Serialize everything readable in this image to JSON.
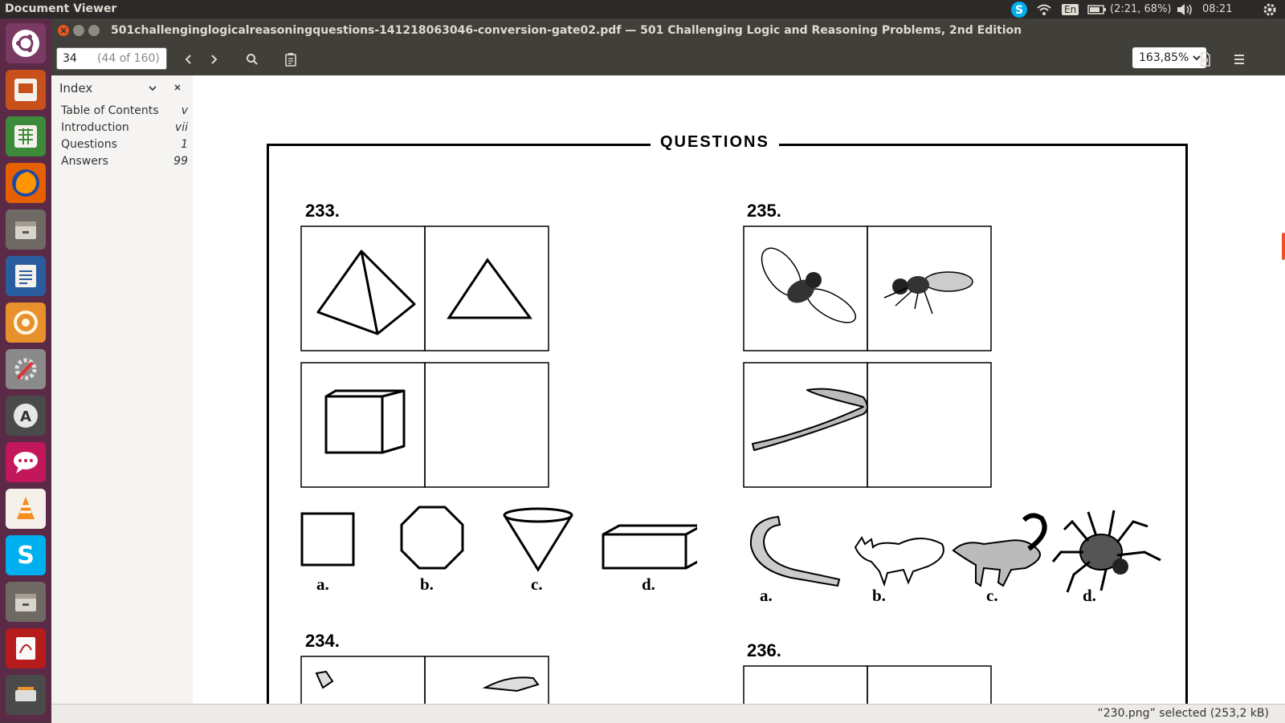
{
  "top_panel": {
    "app_name": "Document Viewer",
    "keyboard": "En",
    "battery": "(2:21, 68%)",
    "time": "08:21"
  },
  "window": {
    "title": "501challenginglogicalreasoningquestions-141218063046-conversion-gate02.pdf — 501 Challenging Logic and Reasoning Problems, 2nd Edition"
  },
  "toolbar": {
    "page_current": "34",
    "page_total": "(44 of 160)",
    "zoom": "163,85%"
  },
  "sidebar": {
    "header": "Index",
    "items": [
      {
        "label": "Table of Contents",
        "page": "v"
      },
      {
        "label": "Introduction",
        "page": "vii"
      },
      {
        "label": "Questions",
        "page": "1"
      },
      {
        "label": "Answers",
        "page": "99"
      }
    ]
  },
  "document": {
    "heading": "QUESTIONS",
    "questions": [
      {
        "number": "233.",
        "options": [
          "a.",
          "b.",
          "c.",
          "d."
        ]
      },
      {
        "number": "235.",
        "options": [
          "a.",
          "b.",
          "c.",
          "d."
        ]
      },
      {
        "number": "234."
      },
      {
        "number": "236."
      }
    ]
  },
  "status": {
    "text": "“230.png” selected  (253,2 kB)"
  },
  "colors": {
    "launcher_bg": "#5a2a47",
    "panel_bg": "#2b2a28",
    "titlebar_bg": "#403f3a",
    "close_btn": "#e95420"
  }
}
